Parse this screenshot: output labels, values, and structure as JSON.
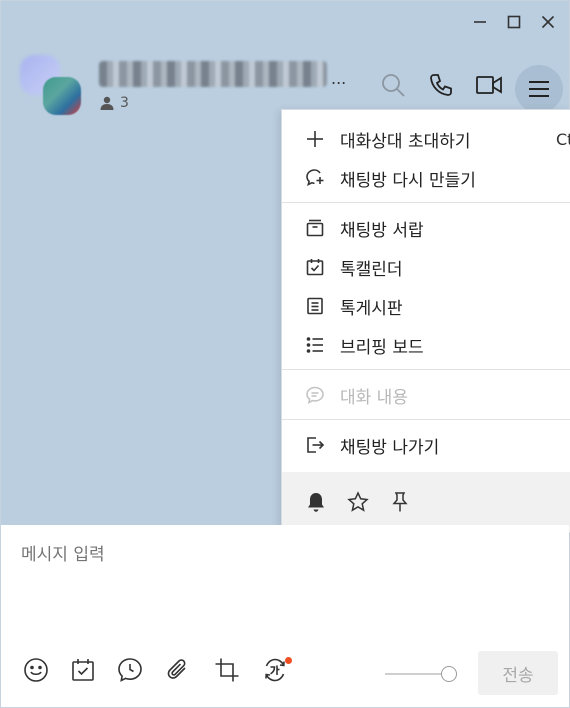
{
  "window": {
    "controls": {
      "minimize": "minimize-icon",
      "maximize": "maximize-icon",
      "close": "close-icon"
    }
  },
  "header": {
    "title": "",
    "title_ellipsis": "...",
    "member_count": "3",
    "icons": [
      "search-icon",
      "phone-icon",
      "video-icon",
      "menu-icon"
    ]
  },
  "menu": {
    "items": [
      {
        "label": "대화상대 초대하기",
        "shortcut": "Ct",
        "icon": "plus-icon"
      },
      {
        "label": "채팅방 다시 만들기",
        "icon": "chat-plus-icon"
      },
      {
        "label": "채팅방 서랍",
        "icon": "drawer-icon"
      },
      {
        "label": "톡캘린더",
        "icon": "calendar-check-icon"
      },
      {
        "label": "톡게시판",
        "icon": "board-icon"
      },
      {
        "label": "브리핑 보드",
        "icon": "list-icon"
      },
      {
        "label": "대화 내용",
        "icon": "chat-bubble-icon",
        "disabled": true
      },
      {
        "label": "채팅방 나가기",
        "icon": "exit-icon"
      }
    ],
    "footer_icons": [
      "bell-icon",
      "star-icon",
      "pin-icon"
    ]
  },
  "input": {
    "placeholder": "메시지 입력",
    "send_label": "전송",
    "toolbar": [
      "emoji-icon",
      "calendar-icon",
      "clock-icon",
      "attach-icon",
      "crop-icon",
      "translate-icon"
    ],
    "accent_dot_color": "#f04e23"
  },
  "colors": {
    "chat_background": "#bacee0",
    "menu_button_background": "#a9bed2"
  }
}
